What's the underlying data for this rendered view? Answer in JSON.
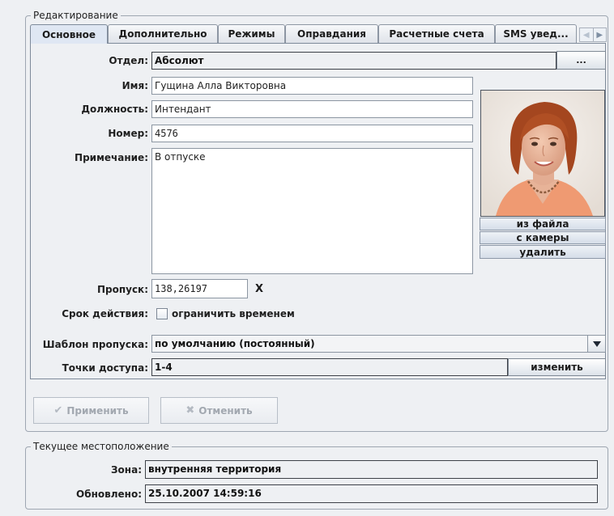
{
  "editing": {
    "group_title": "Редактирование",
    "tabs": [
      {
        "label": "Основное"
      },
      {
        "label": "Дополнительно"
      },
      {
        "label": "Режимы"
      },
      {
        "label": "Оправдания"
      },
      {
        "label": "Расчетные счета"
      },
      {
        "label": "SMS увед..."
      }
    ],
    "form": {
      "department_label": "Отдел:",
      "department_value": "Абсолют",
      "browse_label": "...",
      "name_label": "Имя:",
      "name_value": "Гущина Алла Викторовна",
      "position_label": "Должность:",
      "position_value": "Интендант",
      "number_label": "Номер:",
      "number_value": "4576",
      "note_label": "Примечание:",
      "note_value": "В отпуске",
      "pass_label": "Пропуск:",
      "pass_value": "138,26197",
      "pass_clear_label": "X",
      "validity_label": "Срок действия:",
      "validity_checkbox_label": "ограничить временем",
      "validity_checked": false,
      "template_label": "Шаблон пропуска:",
      "template_value": "по умолчанию (постоянный)",
      "access_label": "Точки доступа:",
      "access_value": "1-4",
      "access_change_label": "изменить"
    },
    "photo_buttons": {
      "from_file": "из файла",
      "from_camera": "с камеры",
      "delete": "удалить"
    },
    "actions": {
      "apply_label": "Применить",
      "cancel_label": "Отменить"
    }
  },
  "location": {
    "group_title": "Текущее местоположение",
    "zone_label": "Зона:",
    "zone_value": "внутренняя территория",
    "updated_label": "Обновлено:",
    "updated_value": "25.10.2007 14:59:16"
  },
  "icons": {
    "apply": "check-icon",
    "cancel": "cross-icon",
    "combo": "triangle-down-icon",
    "tab_scroll_left": "triangle-left-icon",
    "tab_scroll_right": "triangle-right-icon"
  },
  "colors": {
    "background": "#eef0f3",
    "field_border": "#8c96a2",
    "readonly_border": "#3d4148",
    "button_gradient_top": "#ffffff",
    "button_gradient_bottom": "#dde3ea"
  }
}
